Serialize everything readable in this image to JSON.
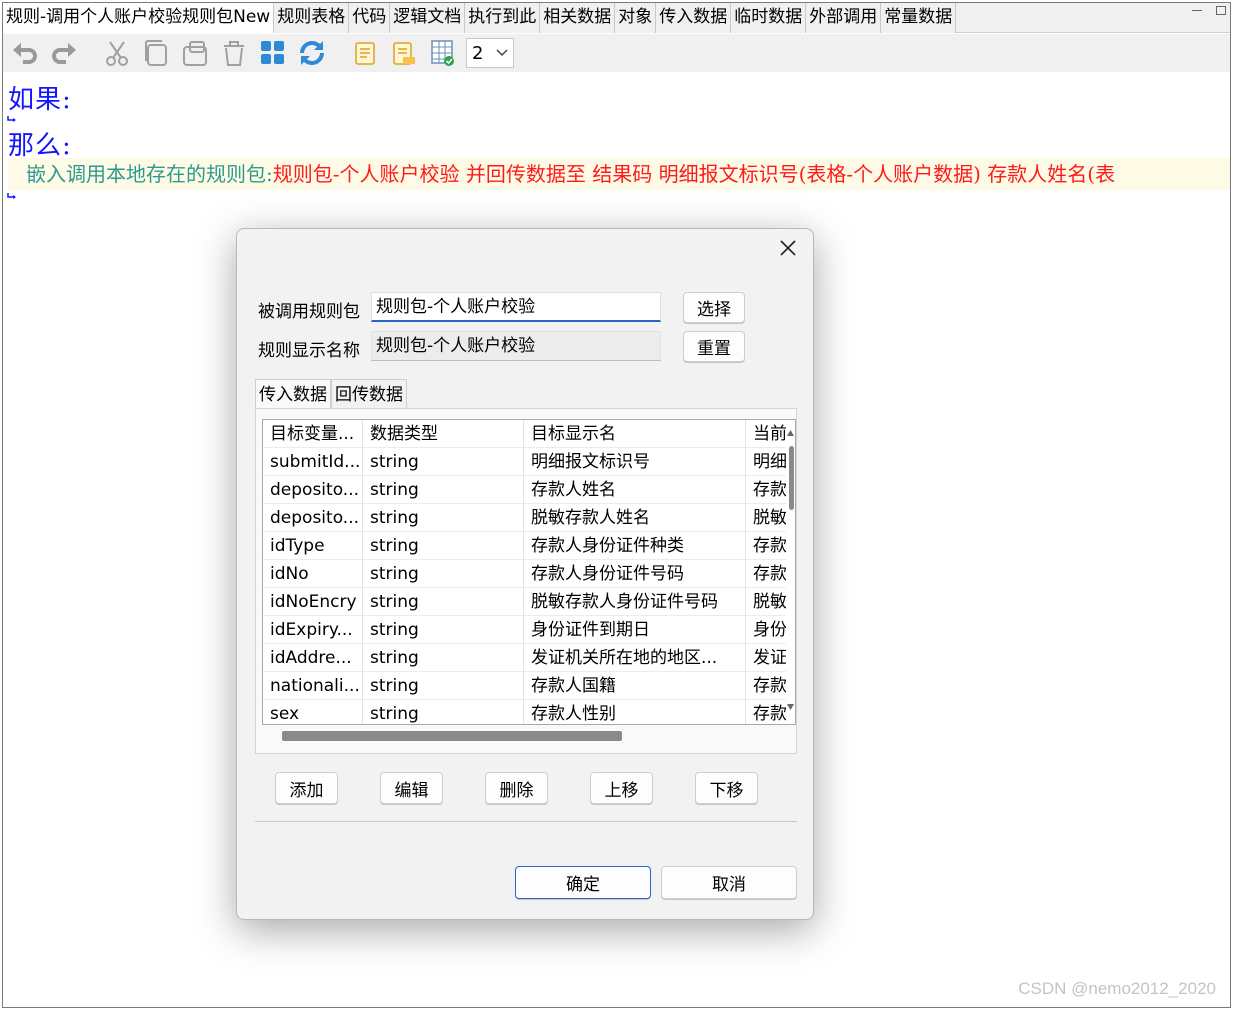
{
  "tabs": [
    {
      "label": "规则-调用个人账户校验规则包New",
      "active": true
    },
    {
      "label": "规则表格"
    },
    {
      "label": "代码"
    },
    {
      "label": "逻辑文档"
    },
    {
      "label": "执行到此"
    },
    {
      "label": "相关数据"
    },
    {
      "label": "对象"
    },
    {
      "label": "传入数据"
    },
    {
      "label": "临时数据"
    },
    {
      "label": "外部调用"
    },
    {
      "label": "常量数据"
    }
  ],
  "toolbar": {
    "icons": [
      "undo-icon",
      "redo-icon",
      "cut-icon",
      "copy-icon",
      "paste-icon",
      "delete-icon",
      "apps-icon",
      "refresh-icon",
      "doc-icon",
      "doc-edit-icon",
      "table-check-icon"
    ],
    "zoom_value": "2"
  },
  "editor": {
    "if_label": "如果:",
    "then_label": "那么:",
    "action_prefix": "嵌入调用本地存在的规则包:",
    "action_text": "规则包-个人账户校验 并回传数据至 结果码 明细报文标识号(表格-个人账户数据) 存款人姓名(表"
  },
  "dialog": {
    "called_pkg_label": "被调用规则包",
    "called_pkg_value": "规则包-个人账户校验",
    "select_label": "选择",
    "display_name_label": "规则显示名称",
    "display_name_value": "规则包-个人账户校验",
    "reset_label": "重置",
    "subtabs": [
      "传入数据",
      "回传数据"
    ],
    "columns": [
      "目标变量...",
      "数据类型",
      "目标显示名",
      "当前"
    ],
    "rows": [
      [
        "submitId...",
        "string",
        "明细报文标识号",
        "明细"
      ],
      [
        "deposito...",
        "string",
        "存款人姓名",
        "存款"
      ],
      [
        "deposito...",
        "string",
        "脱敏存款人姓名",
        "脱敏"
      ],
      [
        "idType",
        "string",
        "存款人身份证件种类",
        "存款"
      ],
      [
        "idNo",
        "string",
        "存款人身份证件号码",
        "存款"
      ],
      [
        "idNoEncry",
        "string",
        "脱敏存款人身份证件号码",
        "脱敏"
      ],
      [
        "idExpiry...",
        "string",
        "身份证件到期日",
        "身份"
      ],
      [
        "idAddre...",
        "string",
        "发证机关所在地的地区...",
        "发证"
      ],
      [
        "nationali...",
        "string",
        "存款人国籍",
        "存款"
      ],
      [
        "sex",
        "string",
        "存款人性别",
        "存款"
      ]
    ],
    "action_buttons": [
      "添加",
      "编辑",
      "删除",
      "上移",
      "下移"
    ],
    "ok_label": "确定",
    "cancel_label": "取消"
  },
  "watermark": "CSDN @nemo2012_2020"
}
